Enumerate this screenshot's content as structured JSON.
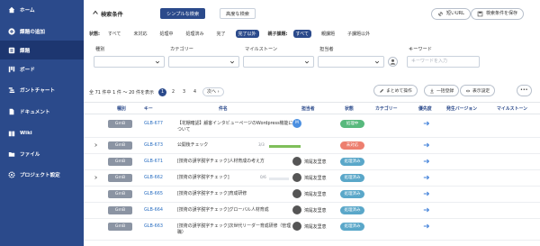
{
  "sidebar": {
    "items": [
      {
        "label": "ホーム",
        "icon": "home-icon",
        "active": false
      },
      {
        "label": "課題の追加",
        "icon": "add-circle-icon",
        "active": false
      },
      {
        "label": "課題",
        "icon": "list-icon",
        "active": true
      },
      {
        "label": "ボード",
        "icon": "board-icon",
        "active": false
      },
      {
        "label": "ガントチャート",
        "icon": "gantt-icon",
        "active": false
      },
      {
        "label": "ドキュメント",
        "icon": "document-icon",
        "active": false
      },
      {
        "label": "Wiki",
        "icon": "wiki-icon",
        "active": false
      },
      {
        "label": "ファイル",
        "icon": "folder-icon",
        "active": false
      },
      {
        "label": "プロジェクト設定",
        "icon": "gear-icon",
        "active": false
      }
    ]
  },
  "header": {
    "search_title": "検索条件",
    "tab_simple": "シンプルな検索",
    "tab_advanced": "高度な検索",
    "short_url": "短いURL",
    "save_search": "検索条件を保存"
  },
  "status_filter": {
    "label": "状態:",
    "options": [
      "すべて",
      "未対応",
      "処理中",
      "処理済み",
      "完了",
      "完了以外"
    ],
    "selected": "完了以外",
    "parent_label": "親子課題:",
    "parent_options": [
      "すべて",
      "親課題",
      "子課題以外"
    ],
    "parent_selected": "すべて"
  },
  "filters": {
    "type_label": "種別",
    "category_label": "カテゴリー",
    "milestone_label": "マイルストーン",
    "assignee_label": "担当者",
    "keyword_label": "キーワード",
    "keyword_placeholder": "キーワードを入力"
  },
  "results": {
    "summary": "全 71 件中 1 件 〜 20 件を表示",
    "pages": [
      "1",
      "2",
      "3",
      "4"
    ],
    "current_page": "1",
    "next": "次へ ›"
  },
  "actions": {
    "bulk": "まとめて操作",
    "import": "一括登録",
    "display": "表示設定",
    "more": "•••"
  },
  "table": {
    "headers": {
      "type": "種別",
      "key": "キー",
      "summary": "件名",
      "assignee": "担当者",
      "status": "状態",
      "category": "カテゴリー",
      "priority": "優先度",
      "version": "発生バージョン",
      "milestone": "マイルストーン"
    },
    "rows": [
      {
        "type": "GmB",
        "key": "GLB-677",
        "summary": "【花棚確認】顧客インタビューページのWordpress機能について",
        "assignee": "",
        "avatar": "M",
        "status": "処理中",
        "status_color": "#58b97d",
        "progress": "",
        "progress_value": null,
        "expand": false
      },
      {
        "type": "GmB",
        "key": "GLB-673",
        "summary": "公開後チェック",
        "assignee": "",
        "avatar": "",
        "status": "未対応",
        "status_color": "#ed7f6f",
        "progress": "3/3",
        "progress_value": 1.0,
        "expand": true
      },
      {
        "type": "GmB",
        "key": "GLB-671",
        "summary": "[技術の誤字脱字チェック]人材育成の考え方",
        "assignee": "鴻尾友里恵",
        "avatar": "",
        "status": "処理済み",
        "status_color": "#5aa7c9",
        "progress": "",
        "progress_value": null,
        "expand": false
      },
      {
        "type": "GmB",
        "key": "GLB-662",
        "summary": "[技術の誤字脱字チェック]",
        "assignee": "鴻尾友里恵",
        "avatar": "",
        "status": "処理済み",
        "status_color": "#5aa7c9",
        "progress": "0/6",
        "progress_value": 0.0,
        "expand": true
      },
      {
        "type": "GmB",
        "key": "GLB-665",
        "summary": "[技術の誤字脱字チェック]育成研修",
        "assignee": "鴻尾友里恵",
        "avatar": "",
        "status": "処理済み",
        "status_color": "#5aa7c9",
        "progress": "",
        "progress_value": null,
        "expand": false
      },
      {
        "type": "GmB",
        "key": "GLB-664",
        "summary": "[技術の誤字脱字チェック]グローバル人材育成",
        "assignee": "鴻尾友里恵",
        "avatar": "",
        "status": "処理済み",
        "status_color": "#5aa7c9",
        "progress": "",
        "progress_value": null,
        "expand": false
      },
      {
        "type": "GmB",
        "key": "GLB-663",
        "summary": "[技術の誤字脱字チェック]次世代リーダー育成研修（管理職）",
        "assignee": "鴻尾友里恵",
        "avatar": "",
        "status": "処理済み",
        "status_color": "#5aa7c9",
        "progress": "",
        "progress_value": null,
        "expand": false
      }
    ]
  },
  "colors": {
    "brand": "#2b4a8b",
    "sidebar_active": "#1d3670",
    "link": "#2b6fc2",
    "type_badge": "#8b94a3"
  }
}
